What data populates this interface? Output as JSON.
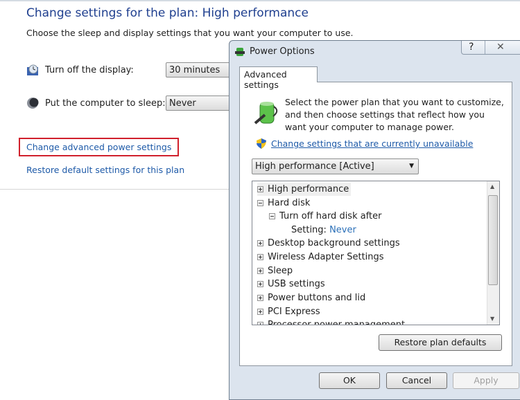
{
  "page": {
    "title": "Change settings for the plan: High performance",
    "subtitle": "Choose the sleep and display settings that you want your computer to use.",
    "display_label": "Turn off the display:",
    "display_value": "30 minutes",
    "sleep_label": "Put the computer to sleep:",
    "sleep_value": "Never",
    "advanced_link": "Change advanced power settings",
    "restore_link": "Restore default settings for this plan"
  },
  "dialog": {
    "title": "Power Options",
    "help": "?",
    "close": "✕",
    "tab": "Advanced settings",
    "description": "Select the power plan that you want to customize, and then choose settings that reflect how you want your computer to manage power.",
    "unavailable_link": "Change settings that are currently unavailable",
    "plan_select": "High performance [Active]",
    "tree": [
      {
        "label": "High performance",
        "state": "collapsed"
      },
      {
        "label": "Hard disk",
        "state": "expanded"
      },
      {
        "label": "Turn off hard disk after",
        "state": "expanded"
      },
      {
        "label": "Setting:",
        "value": "Never"
      },
      {
        "label": "Desktop background settings",
        "state": "collapsed"
      },
      {
        "label": "Wireless Adapter Settings",
        "state": "collapsed"
      },
      {
        "label": "Sleep",
        "state": "collapsed"
      },
      {
        "label": "USB settings",
        "state": "collapsed"
      },
      {
        "label": "Power buttons and lid",
        "state": "collapsed"
      },
      {
        "label": "PCI Express",
        "state": "collapsed"
      },
      {
        "label": "Processor power management",
        "state": "collapsed"
      }
    ],
    "restore_defaults": "Restore plan defaults",
    "ok": "OK",
    "cancel": "Cancel",
    "apply": "Apply"
  },
  "colors": {
    "link": "#1e5aa8",
    "highlight": "#d0202c",
    "title": "#1f3f8f"
  }
}
